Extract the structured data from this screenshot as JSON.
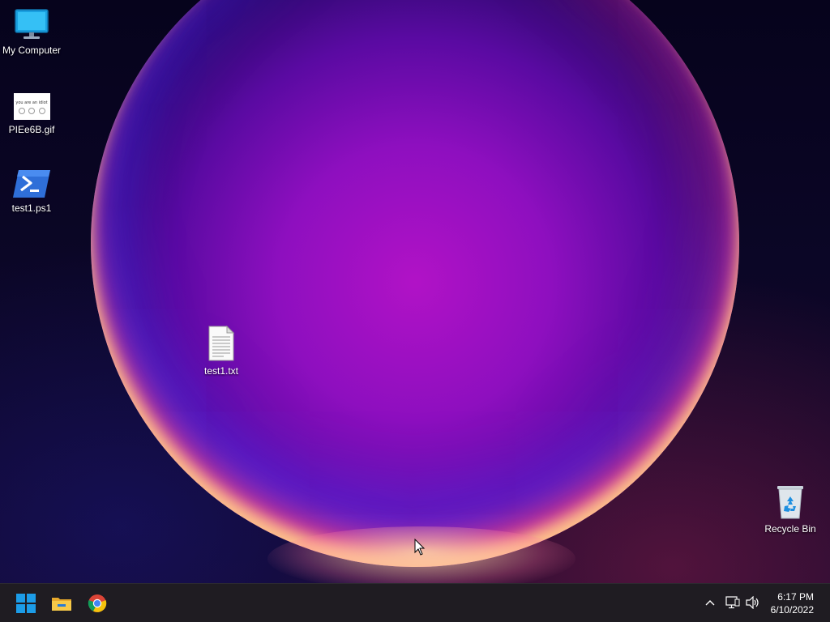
{
  "desktop": {
    "icons": [
      {
        "label": "My Computer",
        "icon": "monitor-icon"
      },
      {
        "label": "PIEe6B.gif",
        "icon": "gif-thumbnail-icon",
        "thumb_text": "you are an idiot"
      },
      {
        "label": "test1.ps1",
        "icon": "powershell-icon"
      },
      {
        "label": "test1.txt",
        "icon": "text-file-icon"
      },
      {
        "label": "Recycle Bin",
        "icon": "recycle-bin-icon"
      }
    ]
  },
  "taskbar": {
    "apps": [
      {
        "name": "Start",
        "icon": "windows-logo-icon"
      },
      {
        "name": "File Explorer",
        "icon": "folder-icon"
      },
      {
        "name": "Google Chrome",
        "icon": "chrome-icon"
      }
    ],
    "tray": [
      "chevron-up-icon",
      "network-icon",
      "volume-icon"
    ],
    "clock": {
      "time": "6:17 PM",
      "date": "6/10/2022"
    }
  },
  "colors": {
    "taskbar": "#1f1c22",
    "accent": "#0a84d8",
    "orb": "#b112c6"
  }
}
